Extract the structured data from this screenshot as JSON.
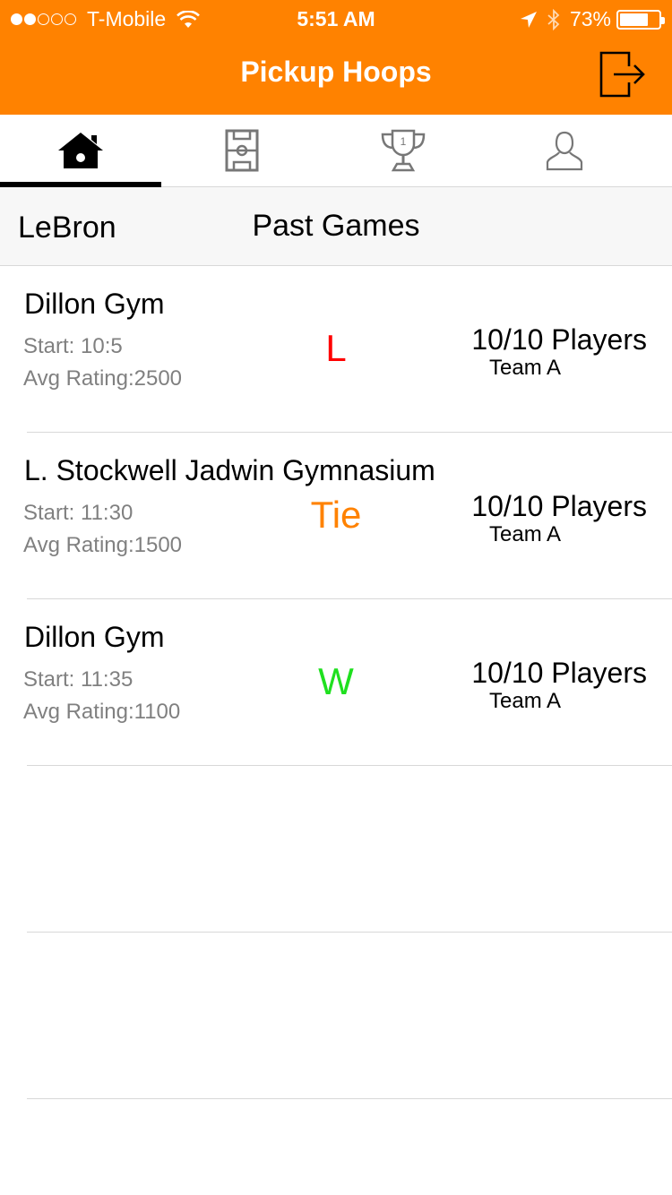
{
  "status_bar": {
    "carrier": "T-Mobile",
    "time": "5:51 AM",
    "battery": "73%",
    "battery_level": 0.73,
    "signal_bars_filled": 2,
    "signal_bars_total": 5
  },
  "nav": {
    "title": "Pickup Hoops",
    "color": "#ff8200"
  },
  "tabs": [
    {
      "icon": "home-icon",
      "active": true
    },
    {
      "icon": "court-icon",
      "active": false
    },
    {
      "icon": "trophy-icon",
      "active": false
    },
    {
      "icon": "profile-icon",
      "active": false
    }
  ],
  "header": {
    "user": "LeBron",
    "section": "Past Games"
  },
  "games": [
    {
      "gym": "Dillon Gym",
      "start": "Start: 10:5",
      "rating": "Avg Rating:2500",
      "result": "L",
      "result_color": "#ff0000",
      "players": "10/10 Players",
      "team": "Team A"
    },
    {
      "gym": "L. Stockwell Jadwin Gymnasium",
      "start": "Start: 11:30",
      "rating": "Avg Rating:1500",
      "result": "Tie",
      "result_color": "#ff8200",
      "players": "10/10 Players",
      "team": "Team A"
    },
    {
      "gym": "Dillon Gym",
      "start": "Start: 11:35",
      "rating": "Avg Rating:1100",
      "result": "W",
      "result_color": "#1fe01f",
      "players": "10/10 Players",
      "team": "Team A"
    }
  ]
}
